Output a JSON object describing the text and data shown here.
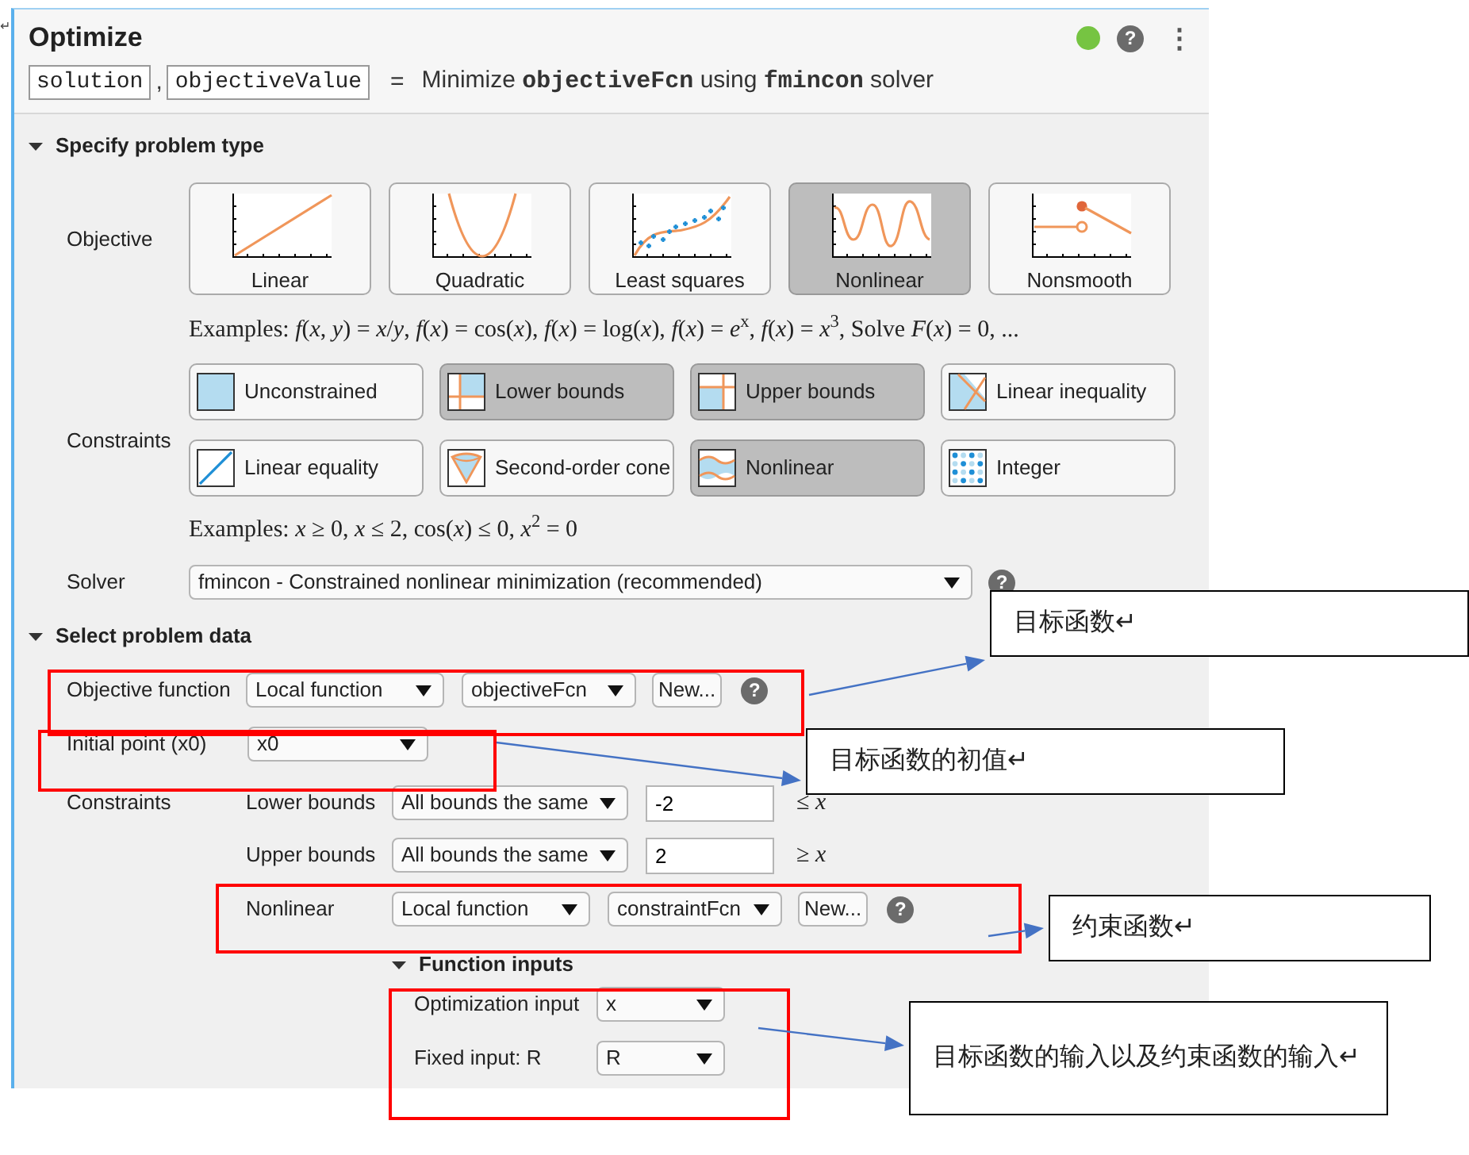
{
  "mark": "↵",
  "header": {
    "title": "Optimize",
    "outputs": [
      "solution",
      "objectiveValue"
    ],
    "separator": ",",
    "equals": "=",
    "description": "Minimize **objectiveFcn** using **fmincon** solver",
    "help": "?",
    "menu": "⋮"
  },
  "problem_type": {
    "title": "Specify problem type",
    "expanded": true,
    "objective_label": "Objective",
    "objectives": [
      {
        "kind": "linear",
        "label": "Linear",
        "selected": false
      },
      {
        "kind": "quadratic",
        "label": "Quadratic",
        "selected": false
      },
      {
        "kind": "leastsquares",
        "label": "Least squares",
        "selected": false
      },
      {
        "kind": "nonlinear",
        "label": "Nonlinear",
        "selected": true
      },
      {
        "kind": "nonsmooth",
        "label": "Nonsmooth",
        "selected": false
      }
    ],
    "objective_examples": "Examples: *f*(*x*, *y*) = *x*/*y*, *f*(*x*) = cos(*x*), *f*(*x*) = log(*x*), *f*(*x*) = *e*$^{x}$, *f*(*x*) = *x*$^{3}$, Solve *F*(*x*) = 0, ...",
    "constraints_label": "Constraints",
    "constraints": [
      {
        "kind": "unconstrained",
        "label": "Unconstrained",
        "selected": false
      },
      {
        "kind": "lower",
        "label": "Lower bounds",
        "selected": true
      },
      {
        "kind": "upper",
        "label": "Upper bounds",
        "selected": true
      },
      {
        "kind": "linineq",
        "label": "Linear inequality",
        "selected": false
      },
      {
        "kind": "lineq",
        "label": "Linear equality",
        "selected": false
      },
      {
        "kind": "cone",
        "label": "Second-order cone",
        "selected": false
      },
      {
        "kind": "nonlinear",
        "label": "Nonlinear",
        "selected": true
      },
      {
        "kind": "integer",
        "label": "Integer",
        "selected": false
      }
    ],
    "constraint_examples": "Examples: *x* ≥ 0, *x* ≤ 2, cos(*x*) ≤ 0, *x*$^{2}$ = 0",
    "solver_label": "Solver",
    "solver": "fmincon - Constrained nonlinear minimization (recommended)",
    "help": "?"
  },
  "problem_data": {
    "title": "Select problem data",
    "expanded": true,
    "objective_function": {
      "label": "Objective function",
      "source": "Local function",
      "function": "objectiveFcn",
      "new_button": "New...",
      "help": "?"
    },
    "initial_point": {
      "label": "Initial point (x0)",
      "value": "x0"
    },
    "constraints_label": "Constraints",
    "constraint_rows": [
      {
        "kind": "bound",
        "label": "Lower bounds",
        "mode": "All bounds the same",
        "value": "-2",
        "relation": "≤ *x*"
      },
      {
        "kind": "bound",
        "label": "Upper bounds",
        "mode": "All bounds the same",
        "value": "2",
        "relation": "≥ *x*"
      },
      {
        "kind": "function",
        "label": "Nonlinear",
        "source": "Local function",
        "function": "constraintFcn",
        "new_button": "New...",
        "help": "?"
      }
    ],
    "function_inputs": {
      "title": "Function inputs",
      "expanded": true,
      "rows": [
        {
          "label": "Optimization input",
          "value": "x"
        },
        {
          "label": "Fixed input: R",
          "value": "R"
        }
      ]
    }
  },
  "annotations": [
    {
      "text": "目标函数↵"
    },
    {
      "text": "目标函数的初值↵"
    },
    {
      "text": "约束函数↵"
    },
    {
      "text": "目标函数的输入以及约束函数的输入↵"
    }
  ]
}
